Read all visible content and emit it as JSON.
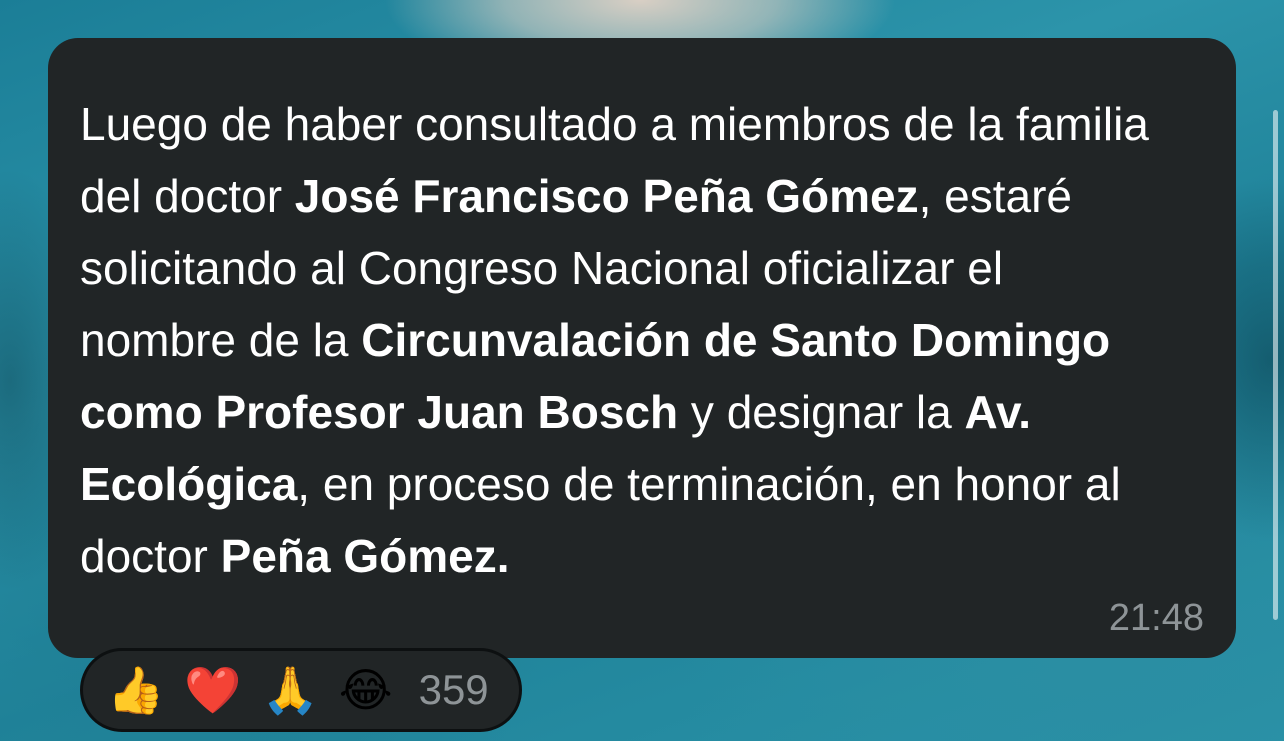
{
  "message": {
    "segments": [
      {
        "text": "Luego de haber consultado a miembros de la familia del doctor ",
        "bold": false
      },
      {
        "text": "José Francisco Peña Gómez",
        "bold": true
      },
      {
        "text": ", estaré solicitando al Congreso Nacional oficializar el nombre de la ",
        "bold": false
      },
      {
        "text": "Circunvalación de Santo Domingo como Profesor Juan Bosch",
        "bold": true
      },
      {
        "text": " y designar la ",
        "bold": false
      },
      {
        "text": "Av. Ecológica",
        "bold": true
      },
      {
        "text": ", en proceso de terminación, en honor al doctor ",
        "bold": false
      },
      {
        "text": "Peña Gómez.",
        "bold": true
      }
    ],
    "time": "21:48"
  },
  "reactions": {
    "emojis": [
      {
        "icon": "thumbs-up",
        "glyph": "👍"
      },
      {
        "icon": "red-heart",
        "glyph": "❤️"
      },
      {
        "icon": "folded-hands",
        "glyph": "🙏"
      },
      {
        "icon": "tears-of-joy",
        "glyph": "😂"
      }
    ],
    "count": "359"
  },
  "colors": {
    "bubble_bg": "#212526",
    "text": "#ffffff",
    "meta_text": "#8e9497",
    "background": "#2a8ea3"
  }
}
